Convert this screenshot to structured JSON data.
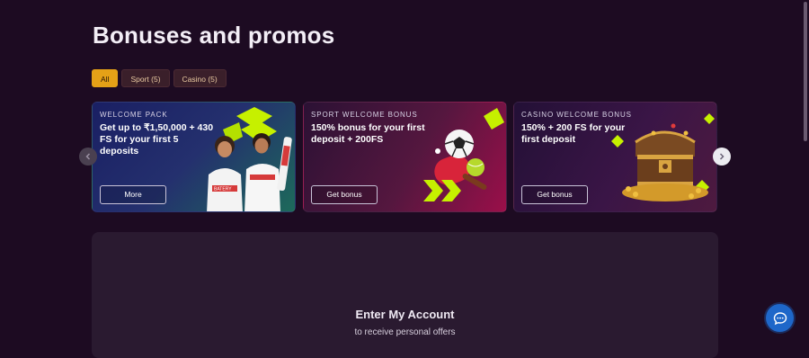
{
  "page": {
    "title": "Bonuses and promos"
  },
  "filters": [
    {
      "label": "All",
      "active": true
    },
    {
      "label": "Sport (5)",
      "active": false
    },
    {
      "label": "Casino (5)",
      "active": false
    }
  ],
  "promos": [
    {
      "label": "WELCOME PACK",
      "title": "Get up to ₹1,50,000 + 430 FS for your first 5 deposits",
      "button": "More",
      "badge": "BATERY"
    },
    {
      "label": "SPORT WELCOME BONUS",
      "title": "150% bonus for your first deposit + 200FS",
      "button": "Get bonus"
    },
    {
      "label": "CASINO WELCOME BONUS",
      "title": "150% + 200 FS for your first deposit",
      "button": "Get bonus"
    }
  ],
  "account": {
    "title": "Enter My Account",
    "subtitle": "to receive personal offers"
  },
  "icons": {
    "carousel_prev": "chevron-left-icon",
    "carousel_next": "chevron-right-icon",
    "chat": "chat-bubble-icon"
  },
  "colors": {
    "accent": "#e5a117",
    "background": "#1d0b22",
    "chat": "#1e67c9",
    "brand_green": "#c6f000"
  }
}
